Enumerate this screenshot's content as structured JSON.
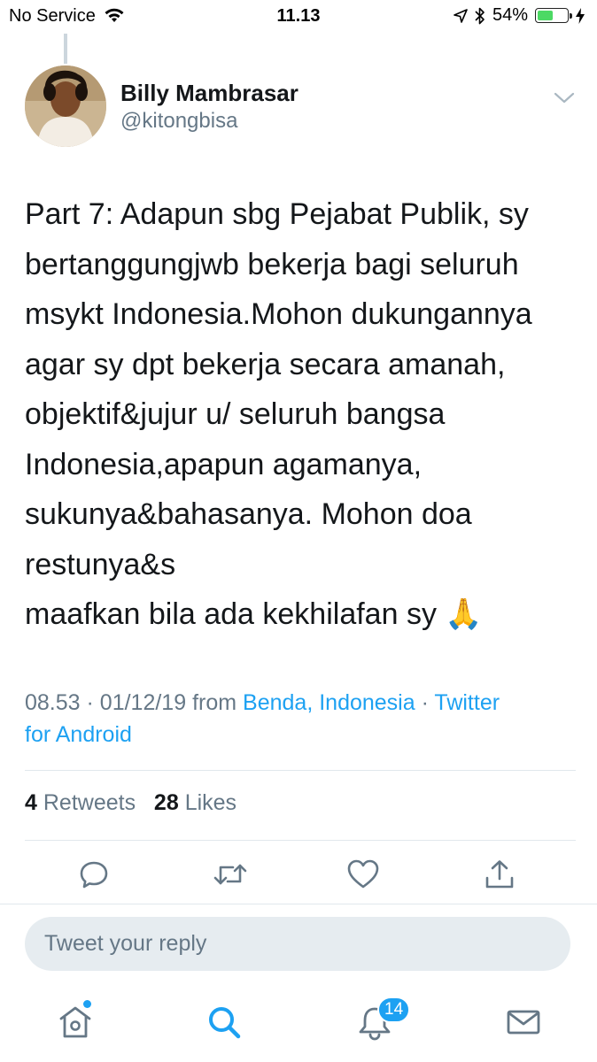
{
  "status_bar": {
    "carrier": "No Service",
    "time": "11.13",
    "battery_percent": "54%",
    "battery_level": 0.54,
    "battery_color": "#4cd964"
  },
  "tweet": {
    "author_name": "Billy Mambrasar",
    "author_handle": "@kitongbisa",
    "text_lines": [
      "Part 7: Adapun sbg Pejabat Publik, sy",
      "bertanggungjwb bekerja bagi seluruh",
      "msykt Indonesia.Mohon dukungannya",
      "agar sy dpt bekerja secara amanah,",
      "objektif&jujur u/ seluruh bangsa",
      "Indonesia,apapun agamanya,",
      "sukunya&bahasanya. Mohon doa",
      "restunya&s",
      "maafkan bila ada kekhilafan sy"
    ],
    "emoji": "🙏",
    "time": "08.53",
    "date": "01/12/19",
    "from_label": "from",
    "location": "Benda, Indonesia",
    "separator": "·",
    "client_part1": "Twitter",
    "client_part2": "for Android"
  },
  "stats": {
    "retweets_count": "4",
    "retweets_label": "Retweets",
    "likes_count": "28",
    "likes_label": "Likes"
  },
  "actions": [
    "reply-icon",
    "retweet-icon",
    "like-icon",
    "share-icon"
  ],
  "reply": {
    "placeholder": "Tweet your reply"
  },
  "tab_bar": {
    "items": [
      "home-icon",
      "search-icon",
      "notifications-icon",
      "messages-icon"
    ],
    "notifications_badge": "14"
  },
  "colors": {
    "accent": "#1da1f2",
    "secondary_text": "#657786",
    "primary_text": "#14171a",
    "divider": "#e1e8ed"
  }
}
